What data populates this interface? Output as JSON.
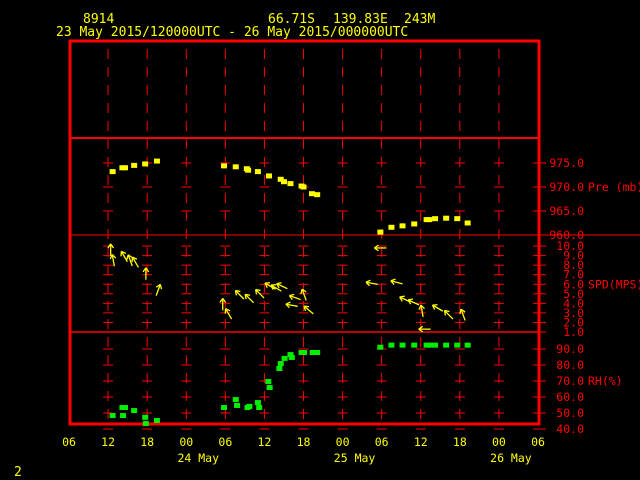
{
  "header": {
    "station_id": "8914",
    "latitude": "66.71S",
    "longitude": "139.83E",
    "elevation": "243M",
    "period": "23 May 2015/120000UTC - 26 May 2015/000000UTC"
  },
  "footer": {
    "page_number": "2"
  },
  "colors": {
    "frame": "#ff0000",
    "text": "#ffff00",
    "pressure": "#ffff00",
    "wind": "#ffff00",
    "rh": "#00ee00"
  },
  "chart_data": {
    "type": "scatter",
    "title": "8914 66.71S 139.83E 243M",
    "x_unit": "hours since 23 May 2015 06UTC",
    "xlim": [
      0,
      72
    ],
    "x_tick_labels": [
      "06",
      "12",
      "18",
      "00",
      "06",
      "12",
      "18",
      "00",
      "06",
      "12",
      "18",
      "00",
      "06"
    ],
    "date_labels": [
      {
        "hour": 18,
        "label": "24 May"
      },
      {
        "hour": 42,
        "label": "25 May"
      },
      {
        "hour": 66,
        "label": "26 May"
      }
    ],
    "panels": [
      {
        "name": "pressure",
        "ylabel": "Pre (mb)",
        "ylim": [
          955,
          980
        ],
        "tick_labels": [
          "975.0",
          "970.0",
          "965.0",
          "960.0"
        ],
        "ticks": [
          975,
          970,
          965,
          960
        ],
        "points": [
          [
            6.7,
            973.1
          ],
          [
            8.2,
            973.9
          ],
          [
            8.6,
            973.9
          ],
          [
            10,
            974.4
          ],
          [
            11.7,
            974.7
          ],
          [
            13.5,
            975.3
          ],
          [
            23.8,
            974.3
          ],
          [
            25.6,
            974.1
          ],
          [
            27.3,
            973.7
          ],
          [
            27.5,
            973.4
          ],
          [
            29,
            973.1
          ],
          [
            30.7,
            972.2
          ],
          [
            32.5,
            971.5
          ],
          [
            33,
            971.0
          ],
          [
            34,
            970.6
          ],
          [
            35.7,
            970.1
          ],
          [
            36,
            969.9
          ],
          [
            37.3,
            968.5
          ],
          [
            38.1,
            968.3
          ],
          [
            47.8,
            960.5
          ],
          [
            49.5,
            961.5
          ],
          [
            51.2,
            961.8
          ],
          [
            53,
            962.2
          ],
          [
            54.9,
            963.1
          ],
          [
            55.3,
            963.1
          ],
          [
            56.2,
            963.3
          ],
          [
            57.9,
            963.4
          ],
          [
            59.6,
            963.3
          ],
          [
            61.2,
            962.4
          ]
        ]
      },
      {
        "name": "wind",
        "ylabel": "SPD(MPS)",
        "ylim": [
          0,
          10.5
        ],
        "tick_labels": [
          "10.0",
          "9.0",
          "8.0",
          "7.0",
          "6.0",
          "5.0",
          "4.0",
          "3.0",
          "2.0",
          "1.0"
        ],
        "ticks": [
          10,
          9,
          8,
          7,
          6,
          5,
          4,
          3,
          2,
          1
        ],
        "points": [
          {
            "h": 6.4,
            "spd": 9.6,
            "dir": 180
          },
          {
            "h": 6.8,
            "spd": 8.5,
            "dir": 170
          },
          {
            "h": 8.5,
            "spd": 8.9,
            "dir": 150
          },
          {
            "h": 9.4,
            "spd": 8.5,
            "dir": 160
          },
          {
            "h": 10.2,
            "spd": 8.3,
            "dir": 150
          },
          {
            "h": 11.8,
            "spd": 7.1,
            "dir": 180
          },
          {
            "h": 13.7,
            "spd": 5.4,
            "dir": 200
          },
          {
            "h": 23.6,
            "spd": 3.9,
            "dir": 180
          },
          {
            "h": 24.5,
            "spd": 2.9,
            "dir": 150
          },
          {
            "h": 26.2,
            "spd": 4.9,
            "dir": 135
          },
          {
            "h": 27.7,
            "spd": 4.5,
            "dir": 135
          },
          {
            "h": 29.3,
            "spd": 5.0,
            "dir": 135
          },
          {
            "h": 30.9,
            "spd": 5.8,
            "dir": 120
          },
          {
            "h": 31.8,
            "spd": 5.6,
            "dir": 120
          },
          {
            "h": 32.7,
            "spd": 5.8,
            "dir": 115
          },
          {
            "h": 34.2,
            "spd": 3.8,
            "dir": 100
          },
          {
            "h": 34.7,
            "spd": 4.6,
            "dir": 110
          },
          {
            "h": 36.1,
            "spd": 4.9,
            "dir": 160
          },
          {
            "h": 36.8,
            "spd": 3.3,
            "dir": 130
          },
          {
            "h": 46.5,
            "spd": 6.1,
            "dir": 100
          },
          {
            "h": 47.8,
            "spd": 9.8,
            "dir": 90
          },
          {
            "h": 50.3,
            "spd": 6.2,
            "dir": 105
          },
          {
            "h": 51.6,
            "spd": 4.4,
            "dir": 115
          },
          {
            "h": 52.9,
            "spd": 4.1,
            "dir": 115
          },
          {
            "h": 54.2,
            "spd": 3.2,
            "dir": 170
          },
          {
            "h": 54.6,
            "spd": 1.3,
            "dir": 90
          },
          {
            "h": 56.6,
            "spd": 3.5,
            "dir": 120
          },
          {
            "h": 58.3,
            "spd": 2.8,
            "dir": 135
          },
          {
            "h": 60.5,
            "spd": 2.8,
            "dir": 160
          }
        ]
      },
      {
        "name": "rh",
        "ylabel": "RH(%)",
        "ylim": [
          40,
          95
        ],
        "tick_labels": [
          "90.0",
          "80.0",
          "70.0",
          "60.0",
          "50.0",
          "40.0"
        ],
        "ticks": [
          90,
          80,
          70,
          60,
          50,
          40
        ],
        "points": [
          [
            6.7,
            48.1
          ],
          [
            8.2,
            53.1
          ],
          [
            8.6,
            53.1
          ],
          [
            8.3,
            48.1
          ],
          [
            10,
            51.2
          ],
          [
            11.7,
            47
          ],
          [
            11.8,
            43.1
          ],
          [
            13.5,
            45
          ],
          [
            23.8,
            53.1
          ],
          [
            25.6,
            58.1
          ],
          [
            25.8,
            54.4
          ],
          [
            27.4,
            53.1
          ],
          [
            27.7,
            53.8
          ],
          [
            29,
            56.2
          ],
          [
            29.2,
            53.1
          ],
          [
            30.6,
            69.4
          ],
          [
            30.8,
            65.6
          ],
          [
            32.3,
            77.5
          ],
          [
            32.5,
            80.6
          ],
          [
            33.1,
            83.8
          ],
          [
            34,
            86.2
          ],
          [
            34.2,
            84.4
          ],
          [
            35.7,
            87.5
          ],
          [
            36.1,
            87.5
          ],
          [
            37.4,
            87.5
          ],
          [
            38.1,
            87.5
          ],
          [
            47.8,
            90.8
          ],
          [
            49.5,
            92.1
          ],
          [
            51.2,
            92.1
          ],
          [
            53,
            92.1
          ],
          [
            54.9,
            92.1
          ],
          [
            55.4,
            92.1
          ],
          [
            56.2,
            92.1
          ],
          [
            57.9,
            92.1
          ],
          [
            59.6,
            92.1
          ],
          [
            61.2,
            92.1
          ]
        ]
      }
    ]
  }
}
